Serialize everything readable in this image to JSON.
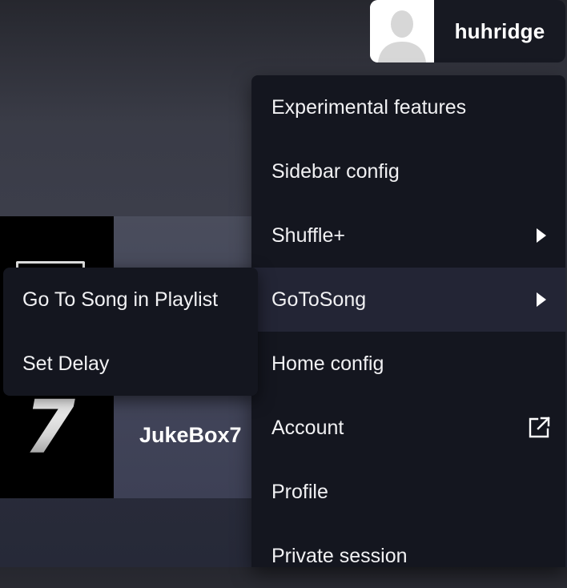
{
  "user": {
    "username": "huhridge",
    "avatar_icon": "user-silhouette-icon"
  },
  "playlist_card": {
    "title": "JukeBox7",
    "art_number": "7"
  },
  "menu": {
    "items": [
      {
        "label": "Experimental features"
      },
      {
        "label": "Sidebar config"
      },
      {
        "label": "Shuffle+",
        "icon": "chevron-right-icon"
      },
      {
        "label": "GoToSong",
        "icon": "chevron-right-icon",
        "active": true
      },
      {
        "label": "Home config"
      },
      {
        "label": "Account",
        "icon": "external-link-icon"
      },
      {
        "label": "Profile"
      },
      {
        "label": "Private session"
      }
    ]
  },
  "submenu": {
    "items": [
      {
        "label": "Go To Song in Playlist"
      },
      {
        "label": "Set Delay"
      }
    ]
  },
  "colors": {
    "menu_bg": "#14161f",
    "menu_active_bg": "#232535",
    "text": "#f1f1f3"
  }
}
